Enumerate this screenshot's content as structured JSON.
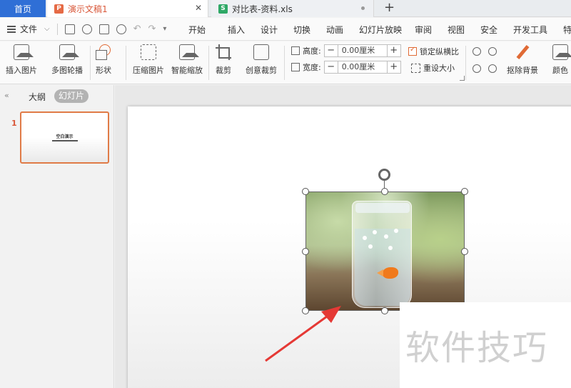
{
  "tabs": {
    "home": "首页",
    "active_doc": "演示文稿1",
    "second_doc": "对比表-资料.xls",
    "ppt_icon_letter": "P",
    "xls_icon_letter": "S",
    "add": "+"
  },
  "menu": {
    "file": "文件",
    "items": [
      "开始",
      "插入",
      "设计",
      "切换",
      "动画",
      "幻灯片放映",
      "审阅",
      "视图",
      "安全",
      "开发工具",
      "特色"
    ]
  },
  "ribbon": {
    "insert_picture": "插入图片",
    "multi_carousel": "多图轮播",
    "shape": "形状",
    "compress_picture": "压缩图片",
    "smart_zoom": "智能缩放",
    "crop": "裁剪",
    "creative_crop": "创意裁剪",
    "height_label": "高度:",
    "height_value": "0.00厘米",
    "width_label": "宽度:",
    "width_value": "0.00厘米",
    "lock_ratio": "锁定纵横比",
    "reset_size": "重设大小",
    "remove_background": "抠除背景",
    "color": "颜色"
  },
  "left_panel": {
    "outline_tab": "大纲",
    "slides_tab": "幻灯片",
    "slide_number": "1",
    "thumb_title": "空白演示"
  },
  "watermark": "软件技巧",
  "colors": {
    "home_tab": "#2f6fd6",
    "accent_orange": "#e07b47",
    "arrow_red": "#e53935"
  }
}
